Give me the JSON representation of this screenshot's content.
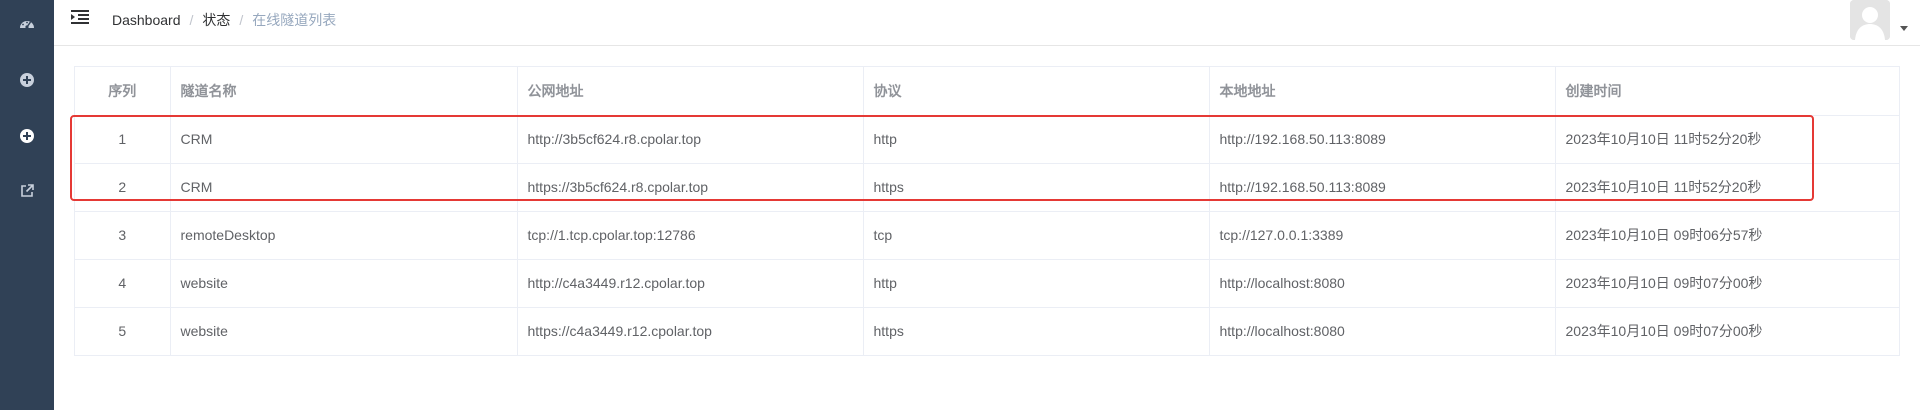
{
  "breadcrumb": {
    "items": [
      "Dashboard",
      "状态"
    ],
    "separator": "/",
    "current": "在线隧道列表"
  },
  "sidebar": {
    "icons": [
      "dashboard-icon",
      "tunnel-status-icon",
      "tunnel-list-icon",
      "external-link-icon"
    ]
  },
  "table": {
    "headers": [
      "序列",
      "隧道名称",
      "公网地址",
      "协议",
      "本地地址",
      "创建时间"
    ],
    "rows": [
      [
        "1",
        "CRM",
        "http://3b5cf624.r8.cpolar.top",
        "http",
        "http://192.168.50.113:8089",
        "2023年10月10日 11时52分20秒"
      ],
      [
        "2",
        "CRM",
        "https://3b5cf624.r8.cpolar.top",
        "https",
        "http://192.168.50.113:8089",
        "2023年10月10日 11时52分20秒"
      ],
      [
        "3",
        "remoteDesktop",
        "tcp://1.tcp.cpolar.top:12786",
        "tcp",
        "tcp://127.0.0.1:3389",
        "2023年10月10日 09时06分57秒"
      ],
      [
        "4",
        "website",
        "http://c4a3449.r12.cpolar.top",
        "http",
        "http://localhost:8080",
        "2023年10月10日 09时07分00秒"
      ],
      [
        "5",
        "website",
        "https://c4a3449.r12.cpolar.top",
        "https",
        "http://localhost:8080",
        "2023年10月10日 09时07分00秒"
      ]
    ]
  },
  "colors": {
    "sidebar_bg": "#304156",
    "highlight_border": "#e53935",
    "table_border": "#ebeef5"
  }
}
